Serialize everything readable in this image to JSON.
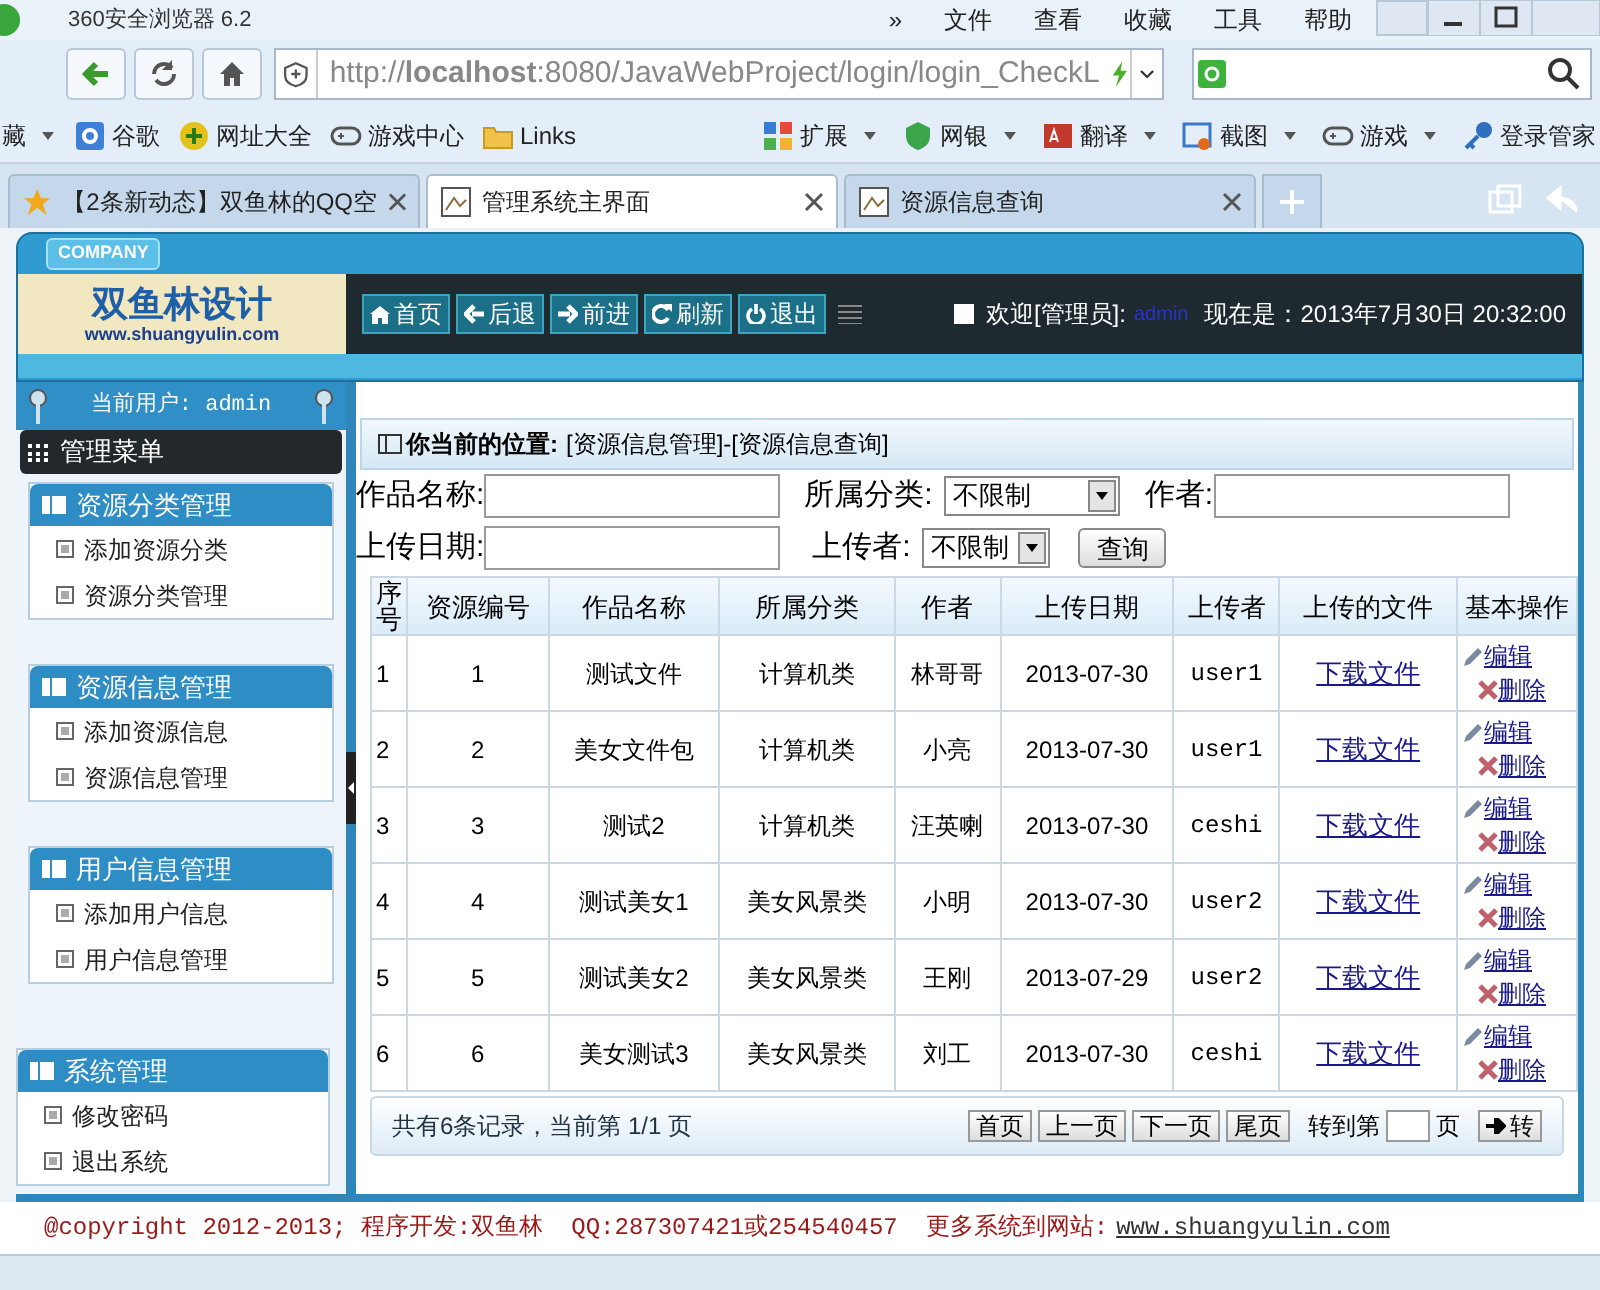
{
  "browser": {
    "title": "360安全浏览器 6.2",
    "menu": [
      "»",
      "文件",
      "查看",
      "收藏",
      "工具",
      "帮助"
    ],
    "url": "http://**localhost**:8080/JavaWebProject/login/login_CheckL",
    "bookmarks_left": [
      {
        "label": "藏",
        "kind": "menu"
      },
      {
        "label": "谷歌",
        "kind": "google"
      },
      {
        "label": "网址大全",
        "kind": "plus"
      },
      {
        "label": "游戏中心",
        "kind": "gamepad"
      },
      {
        "label": "Links",
        "kind": "folder"
      }
    ],
    "bookmarks_right": [
      {
        "label": "扩展",
        "kind": "grid"
      },
      {
        "label": "网银",
        "kind": "shield"
      },
      {
        "label": "翻译",
        "kind": "dict"
      },
      {
        "label": "截图",
        "kind": "scissors"
      },
      {
        "label": "游戏",
        "kind": "gamepad"
      },
      {
        "label": "登录管家",
        "kind": "key"
      }
    ],
    "tabs": [
      {
        "label": "【2条新动态】双鱼林的QQ空",
        "selected": false,
        "kind": "star"
      },
      {
        "label": "管理系统主界面",
        "selected": true,
        "kind": "page"
      },
      {
        "label": "资源信息查询",
        "selected": false,
        "kind": "page"
      }
    ]
  },
  "header": {
    "company": "COMPANY",
    "logo_text": "双鱼林设计",
    "logo_url": "www.shuangyulin.com",
    "nav_buttons": [
      {
        "label": "首页",
        "kind": "home"
      },
      {
        "label": "后退",
        "kind": "back"
      },
      {
        "label": "前进",
        "kind": "forward"
      },
      {
        "label": "刷新",
        "kind": "refresh"
      },
      {
        "label": "退出",
        "kind": "power"
      }
    ],
    "welcome": "欢迎[管理员]:",
    "user": "admin",
    "datetime": "现在是：2013年7月30日 20:32:00"
  },
  "sidebar": {
    "current_user": "当前用户: admin",
    "menu_title": "管理菜单",
    "groups": [
      {
        "title": "资源分类管理",
        "items": [
          "添加资源分类",
          "资源分类管理"
        ]
      },
      {
        "title": "资源信息管理",
        "items": [
          "添加资源信息",
          "资源信息管理"
        ]
      },
      {
        "title": "用户信息管理",
        "items": [
          "添加用户信息",
          "用户信息管理"
        ]
      },
      {
        "title": "系统管理",
        "items": [
          "修改密码",
          "退出系统"
        ]
      }
    ]
  },
  "location": {
    "label": "你当前的位置:",
    "path": "[资源信息管理]-[资源信息查询]"
  },
  "filters": [
    [
      {
        "label": "作品名称:",
        "kind": "text"
      },
      {
        "label": "所属分类:",
        "kind": "select",
        "value": "不限制"
      },
      {
        "label": "作者:",
        "kind": "text"
      }
    ],
    [
      {
        "label": "上传日期:",
        "kind": "text"
      },
      {
        "label": "上传者:",
        "kind": "select",
        "value": "不限制"
      }
    ]
  ],
  "search_button": "查询",
  "table": {
    "columns": [
      "序号",
      "资源编号",
      "作品名称",
      "所属分类",
      "作者",
      "上传日期",
      "上传者",
      "上传的文件",
      "基本操作"
    ],
    "rows": [
      {
        "cells": [
          "1",
          "1",
          "测试文件",
          "计算机类",
          "林哥哥",
          "2013-07-30",
          "user1"
        ],
        "file": "下载文件",
        "actions": [
          "编辑",
          "删除"
        ]
      },
      {
        "cells": [
          "2",
          "2",
          "美女文件包",
          "计算机类",
          "小亮",
          "2013-07-30",
          "user1"
        ],
        "file": "下载文件",
        "actions": [
          "编辑",
          "删除"
        ]
      },
      {
        "cells": [
          "3",
          "3",
          "测试2",
          "计算机类",
          "汪英喇",
          "2013-07-30",
          "ceshi"
        ],
        "file": "下载文件",
        "actions": [
          "编辑",
          "删除"
        ]
      },
      {
        "cells": [
          "4",
          "4",
          "测试美女1",
          "美女风景类",
          "小明",
          "2013-07-30",
          "user2"
        ],
        "file": "下载文件",
        "actions": [
          "编辑",
          "删除"
        ]
      },
      {
        "cells": [
          "5",
          "5",
          "测试美女2",
          "美女风景类",
          "王刚",
          "2013-07-29",
          "user2"
        ],
        "file": "下载文件",
        "actions": [
          "编辑",
          "删除"
        ]
      },
      {
        "cells": [
          "6",
          "6",
          "美女测试3",
          "美女风景类",
          "刘工",
          "2013-07-30",
          "ceshi"
        ],
        "file": "下载文件",
        "actions": [
          "编辑",
          "删除"
        ]
      }
    ]
  },
  "pagination": {
    "summary": "共有6条记录，当前第 1/1 页",
    "buttons": [
      "首页",
      "上一页",
      "下一页",
      "尾页"
    ],
    "goto_label": "转到第",
    "goto_unit": "页",
    "go": "转"
  },
  "footer": {
    "copyright": "@copyright 2012-2013; 程序开发:双鱼林",
    "qq": "QQ:287307421或254540457",
    "more": "更多系统到网站:",
    "site": "www.shuangyulin.com"
  }
}
